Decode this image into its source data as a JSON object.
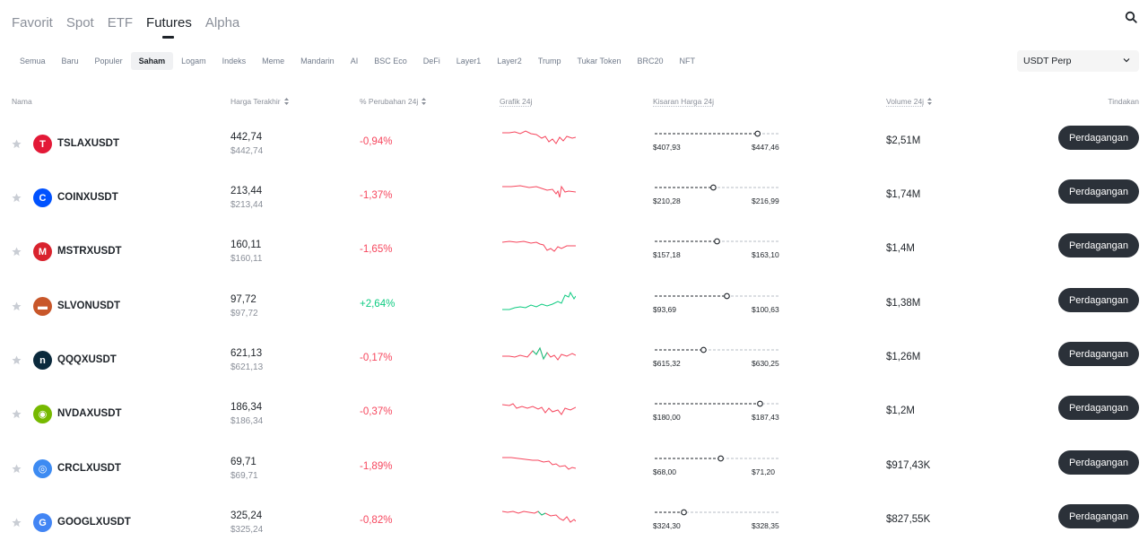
{
  "nav": {
    "tabs": [
      {
        "label": "Favorit"
      },
      {
        "label": "Spot"
      },
      {
        "label": "ETF"
      },
      {
        "label": "Futures"
      },
      {
        "label": "Alpha"
      }
    ],
    "active_index": 3
  },
  "categories": [
    "Semua",
    "Baru",
    "Populer",
    "Saham",
    "Logam",
    "Indeks",
    "Meme",
    "Mandarin",
    "AI",
    "BSC Eco",
    "DeFi",
    "Layer1",
    "Layer2",
    "Trump",
    "Tukar Token",
    "BRC20",
    "NFT"
  ],
  "active_category_index": 3,
  "market_select": {
    "value": "USDT Perp"
  },
  "columns": {
    "name": "Nama",
    "last_price": "Harga Terakhir",
    "change": "% Perubahan 24j",
    "chart": "Grafik 24j",
    "range": "Kisaran Harga 24j",
    "volume": "Volume 24j",
    "action": "Tindakan"
  },
  "colors": {
    "negative": "#f6465d",
    "positive": "#0ecb81",
    "button": "#2b3139"
  },
  "rows": [
    {
      "symbol": "TSLAXUSDT",
      "price": "442,74",
      "price_usd": "$442,74",
      "change": "-0,94%",
      "dir": "neg",
      "low": "$407,93",
      "high": "$447,46",
      "range_pos": 0.83,
      "volume": "$2,51M",
      "action": "Perdagangan",
      "icon": "tesla-icon",
      "icon_color": "#e31937",
      "glyph": "T"
    },
    {
      "symbol": "COINXUSDT",
      "price": "213,44",
      "price_usd": "$213,44",
      "change": "-1,37%",
      "dir": "neg",
      "low": "$210,28",
      "high": "$216,99",
      "range_pos": 0.47,
      "volume": "$1,74M",
      "action": "Perdagangan",
      "icon": "coinbase-icon",
      "icon_color": "#0052ff",
      "glyph": "C"
    },
    {
      "symbol": "MSTRXUSDT",
      "price": "160,11",
      "price_usd": "$160,11",
      "change": "-1,65%",
      "dir": "neg",
      "low": "$157,18",
      "high": "$163,10",
      "range_pos": 0.5,
      "volume": "$1,4M",
      "action": "Perdagangan",
      "icon": "microstrategy-icon",
      "icon_color": "#d9232e",
      "glyph": "M"
    },
    {
      "symbol": "SLVONUSDT",
      "price": "97,72",
      "price_usd": "$97,72",
      "change": "+2,64%",
      "dir": "pos",
      "low": "$93,69",
      "high": "$100,63",
      "range_pos": 0.58,
      "volume": "$1,38M",
      "action": "Perdagangan",
      "icon": "silver-icon",
      "icon_color": "#c8572a",
      "glyph": "▬"
    },
    {
      "symbol": "QQQXUSDT",
      "price": "621,13",
      "price_usd": "$621,13",
      "change": "-0,17%",
      "dir": "neg",
      "low": "$615,32",
      "high": "$630,25",
      "range_pos": 0.39,
      "volume": "$1,26M",
      "action": "Perdagangan",
      "icon": "invesco-icon",
      "icon_color": "#0b2a3c",
      "glyph": "n"
    },
    {
      "symbol": "NVDAXUSDT",
      "price": "186,34",
      "price_usd": "$186,34",
      "change": "-0,37%",
      "dir": "neg",
      "low": "$180,00",
      "high": "$187,43",
      "range_pos": 0.85,
      "volume": "$1,2M",
      "action": "Perdagangan",
      "icon": "nvidia-icon",
      "icon_color": "#76b900",
      "glyph": "◉"
    },
    {
      "symbol": "CRCLXUSDT",
      "price": "69,71",
      "price_usd": "$69,71",
      "change": "-1,89%",
      "dir": "neg",
      "low": "$68,00",
      "high": "$71,20",
      "range_pos": 0.53,
      "volume": "$917,43K",
      "action": "Perdagangan",
      "icon": "circle-icon",
      "icon_color": "#3d8bf2",
      "glyph": "◎"
    },
    {
      "symbol": "GOOGLXUSDT",
      "price": "325,24",
      "price_usd": "$325,24",
      "change": "-0,82%",
      "dir": "neg",
      "low": "$324,30",
      "high": "$328,35",
      "range_pos": 0.23,
      "volume": "$827,55K",
      "action": "Perdagangan",
      "icon": "google-icon",
      "icon_color": "#4285f4",
      "glyph": "G"
    }
  ]
}
